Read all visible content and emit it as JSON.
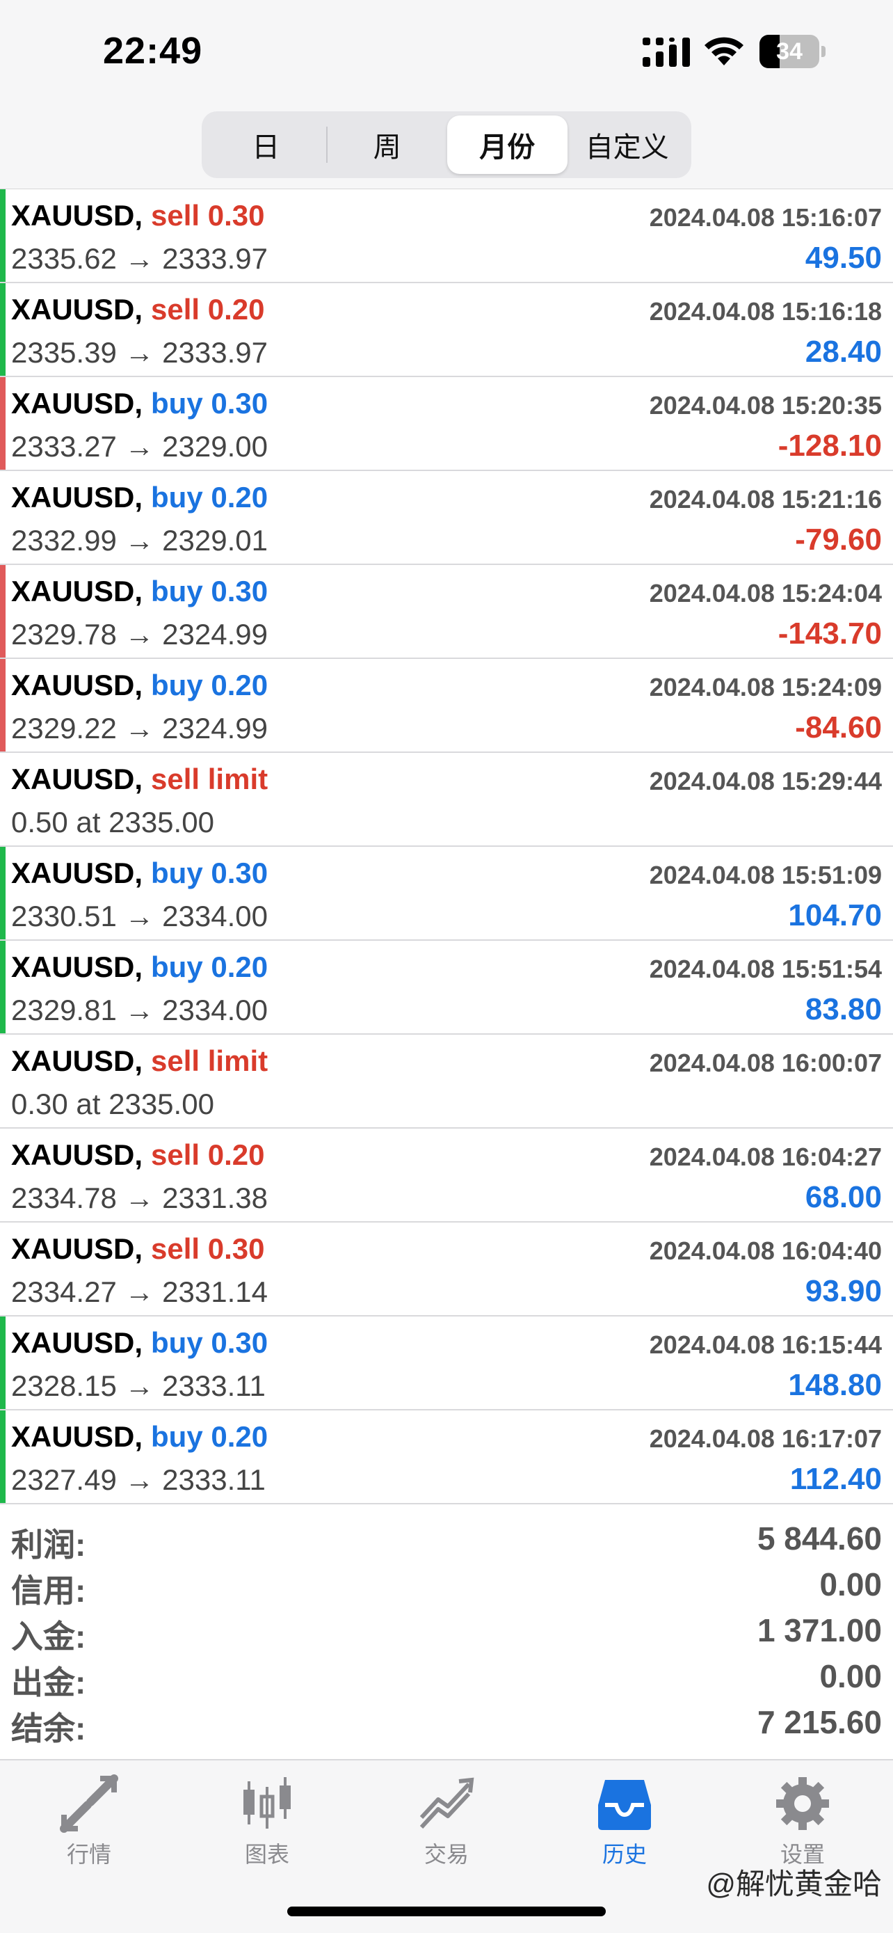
{
  "status_bar": {
    "time": "22:49",
    "battery": "34",
    "battery_level": 0.34
  },
  "segments": [
    {
      "label": "日",
      "active": false
    },
    {
      "label": "周",
      "active": false
    },
    {
      "label": "月份",
      "active": true
    },
    {
      "label": "自定义",
      "active": false
    }
  ],
  "colors": {
    "sell": "#d93b2b",
    "buy": "#1a73e0",
    "profit_positive": "#1a73e0",
    "profit_negative": "#d93b2b",
    "bar_green": "#1fb84b",
    "bar_red": "#e05a5a",
    "accent": "#1a73e0"
  },
  "rows": [
    {
      "symbol": "XAUUSD,",
      "action": "sell 0.30",
      "type": "sell",
      "time": "2024.04.08 15:16:07",
      "prices": "2335.62 → 2333.97",
      "profit": "49.50",
      "bar": "green"
    },
    {
      "symbol": "XAUUSD,",
      "action": "sell 0.20",
      "type": "sell",
      "time": "2024.04.08 15:16:18",
      "prices": "2335.39 → 2333.97",
      "profit": "28.40",
      "bar": "green"
    },
    {
      "symbol": "XAUUSD,",
      "action": "buy 0.30",
      "type": "buy",
      "time": "2024.04.08 15:20:35",
      "prices": "2333.27 → 2329.00",
      "profit": "-128.10",
      "bar": "red"
    },
    {
      "symbol": "XAUUSD,",
      "action": "buy 0.20",
      "type": "buy",
      "time": "2024.04.08 15:21:16",
      "prices": "2332.99 → 2329.01",
      "profit": "-79.60",
      "bar": "none"
    },
    {
      "symbol": "XAUUSD,",
      "action": "buy 0.30",
      "type": "buy",
      "time": "2024.04.08 15:24:04",
      "prices": "2329.78 → 2324.99",
      "profit": "-143.70",
      "bar": "red"
    },
    {
      "symbol": "XAUUSD,",
      "action": "buy 0.20",
      "type": "buy",
      "time": "2024.04.08 15:24:09",
      "prices": "2329.22 → 2324.99",
      "profit": "-84.60",
      "bar": "red"
    },
    {
      "symbol": "XAUUSD,",
      "action": "sell limit",
      "type": "sell",
      "time": "2024.04.08 15:29:44",
      "prices": "0.50 at 2335.00",
      "profit": "",
      "bar": "none"
    },
    {
      "symbol": "XAUUSD,",
      "action": "buy 0.30",
      "type": "buy",
      "time": "2024.04.08 15:51:09",
      "prices": "2330.51 → 2334.00",
      "profit": "104.70",
      "bar": "green"
    },
    {
      "symbol": "XAUUSD,",
      "action": "buy 0.20",
      "type": "buy",
      "time": "2024.04.08 15:51:54",
      "prices": "2329.81 → 2334.00",
      "profit": "83.80",
      "bar": "green"
    },
    {
      "symbol": "XAUUSD,",
      "action": "sell limit",
      "type": "sell",
      "time": "2024.04.08 16:00:07",
      "prices": "0.30 at 2335.00",
      "profit": "",
      "bar": "none"
    },
    {
      "symbol": "XAUUSD,",
      "action": "sell 0.20",
      "type": "sell",
      "time": "2024.04.08 16:04:27",
      "prices": "2334.78 → 2331.38",
      "profit": "68.00",
      "bar": "none"
    },
    {
      "symbol": "XAUUSD,",
      "action": "sell 0.30",
      "type": "sell",
      "time": "2024.04.08 16:04:40",
      "prices": "2334.27 → 2331.14",
      "profit": "93.90",
      "bar": "none"
    },
    {
      "symbol": "XAUUSD,",
      "action": "buy 0.30",
      "type": "buy",
      "time": "2024.04.08 16:15:44",
      "prices": "2328.15 → 2333.11",
      "profit": "148.80",
      "bar": "green"
    },
    {
      "symbol": "XAUUSD,",
      "action": "buy 0.20",
      "type": "buy",
      "time": "2024.04.08 16:17:07",
      "prices": "2327.49 → 2333.11",
      "profit": "112.40",
      "bar": "green"
    }
  ],
  "summary": [
    {
      "label": "利润:",
      "value": "5 844.60"
    },
    {
      "label": "信用:",
      "value": "0.00"
    },
    {
      "label": "入金:",
      "value": "1 371.00"
    },
    {
      "label": "出金:",
      "value": "0.00"
    },
    {
      "label": "结余:",
      "value": "7 215.60"
    }
  ],
  "tabs": [
    {
      "label": "行情",
      "icon": "quotes-arrows-icon",
      "active": false
    },
    {
      "label": "图表",
      "icon": "candlestick-chart-icon",
      "active": false
    },
    {
      "label": "交易",
      "icon": "trade-chart-icon",
      "active": false
    },
    {
      "label": "历史",
      "icon": "history-inbox-icon",
      "active": true
    },
    {
      "label": "设置",
      "icon": "gear-icon",
      "active": false
    }
  ],
  "watermark": "@解忧黄金哈"
}
